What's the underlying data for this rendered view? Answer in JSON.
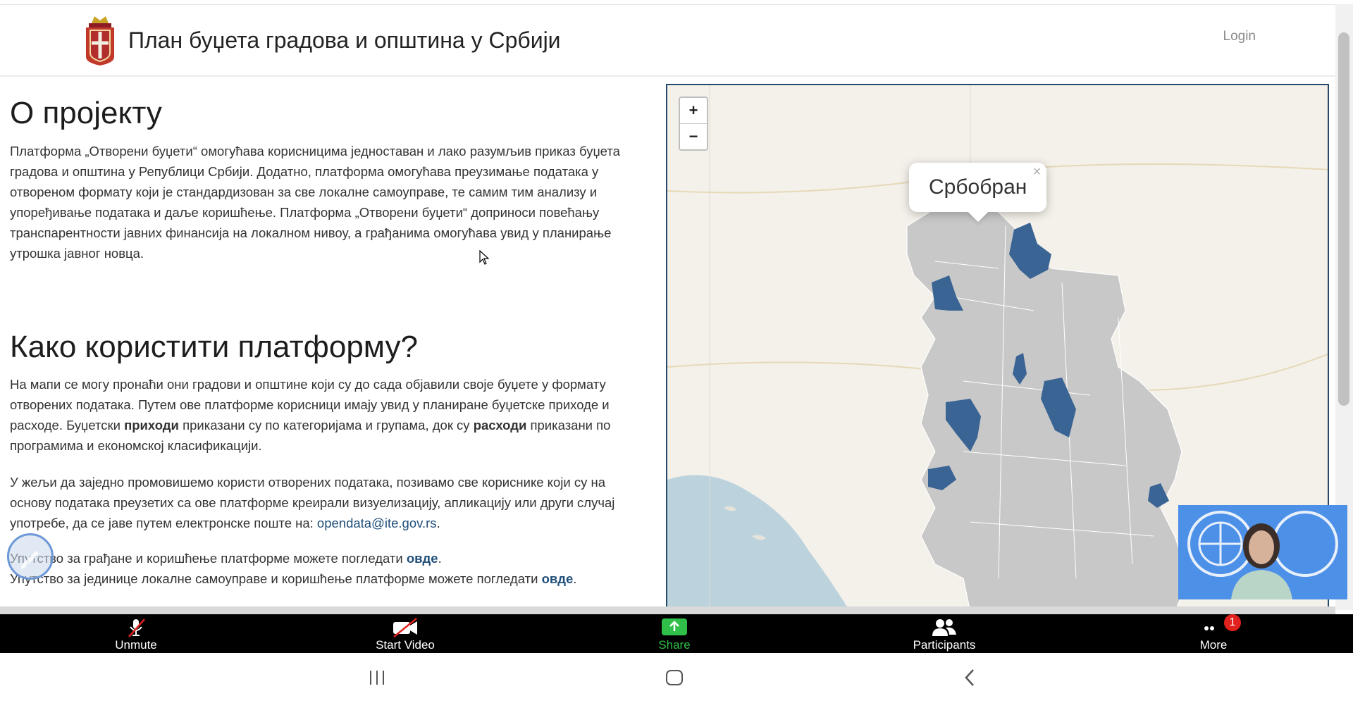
{
  "header": {
    "title": "План буџета градова и општина у Србији",
    "login_label": "Login"
  },
  "about": {
    "heading": "О пројекту",
    "text": "Платформа „Отворени буџети“ омогућава корисницима једноставан и лако разумљив приказ буџета градова и општина у Републици Србији. Додатно, платформа омогућава преузимање података у отвореном формату који је стандардизован за све локалне самоуправе, те самим тим анализу и упоређивање података и даље коришћење. Платформа „Отворени буџети“ доприноси повећању транспарентности јавних финансија на локалном нивоу, а грађанима омогућава увид у планирање утрошка јавног новца."
  },
  "how": {
    "heading": "Како користити платформу?",
    "p1_a": "На мапи се могу пронаћи они градови и општине који су до сада објавили своје буџете у формату отворених података. Путем ове платформе корисници имају увид у планиране буџетске приходе и расходе. Буџетски ",
    "p1_bold1": "приходи",
    "p1_b": " приказани су по категоријама и групама, док су ",
    "p1_bold2": "расходи",
    "p1_c": " приказани по програмима и економској класификацији.",
    "p2_a": "У жељи да заједно промовишемо користи отворених података, позивамо све кориснике који су на основу података преузетих са ове платформе креирали визуелизацију, апликацију или други случај употребе, да се јаве путем електронске поште на: ",
    "p2_email": "opendata@ite.gov.rs",
    "p2_end": ".",
    "guide1_a": "Упутство за грађане и коришћење платформе можете погледати ",
    "guide1_link": "овде",
    "guide1_end": ".",
    "guide2_a": "Упутство за јединице локалне самоуправе и коришћење платформе можете погледати ",
    "guide2_link": "овде",
    "guide2_end": "."
  },
  "map": {
    "zoom_in": "+",
    "zoom_out": "−",
    "popup_label": "Србобран",
    "popup_close": "×",
    "highlight_color": "#3a6494",
    "region_color": "#c8c8c8"
  },
  "zoom_toolbar": {
    "unmute": "Unmute",
    "start_video": "Start Video",
    "share": "Share",
    "participants": "Participants",
    "more": "More",
    "more_badge": "1"
  }
}
